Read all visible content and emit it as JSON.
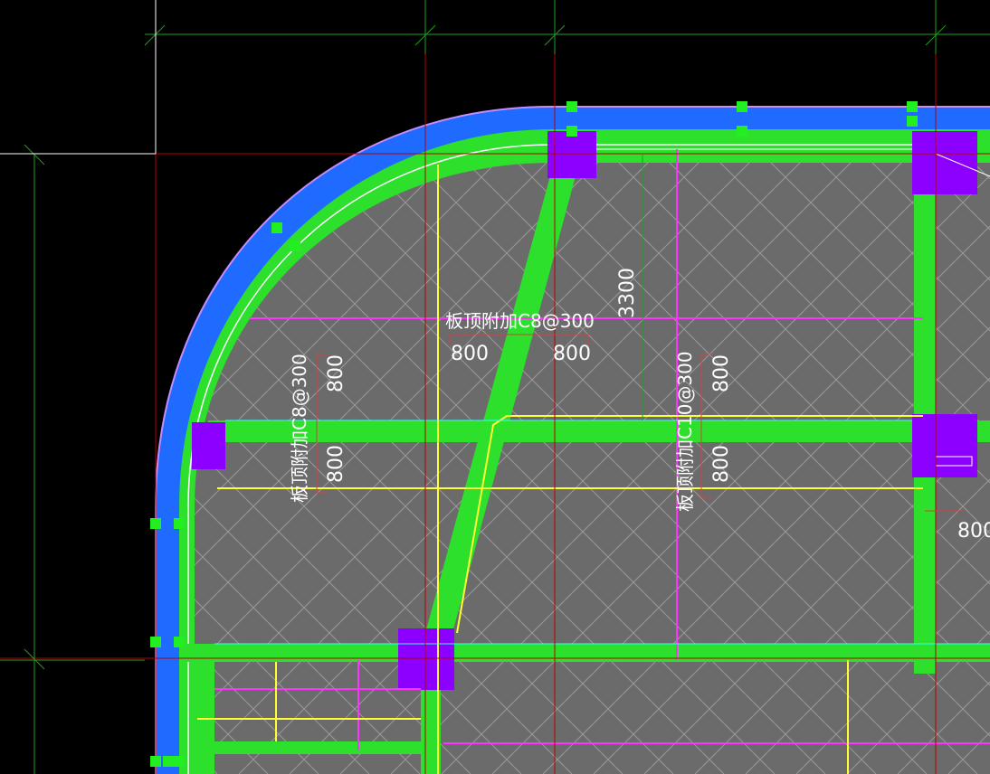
{
  "drawing": {
    "colors": {
      "background": "#000000",
      "slab": "#6b6b6b",
      "beam": "#2ce02c",
      "edge_band": "#1f6bff",
      "column": "#8b00ff",
      "rebar_magenta": "#ff33ff",
      "rebar_yellow": "#ffff33",
      "axis_red": "#b40000",
      "axis_green": "#1f9f1f",
      "hatch": "#9a9a9a",
      "text": "#ffffff"
    },
    "annotations": {
      "rebar_top": "板顶附加C8@300",
      "rebar_left": "板顶附加C8@300",
      "rebar_mid": "板顶附加C10@300",
      "dim_3300": "3300",
      "dim_800_a": "800",
      "dim_800_b": "800",
      "dim_800_c": "800",
      "dim_800_d": "800",
      "dim_800_e": "800",
      "dim_800_f": "800",
      "dim_800_g": "800"
    }
  }
}
